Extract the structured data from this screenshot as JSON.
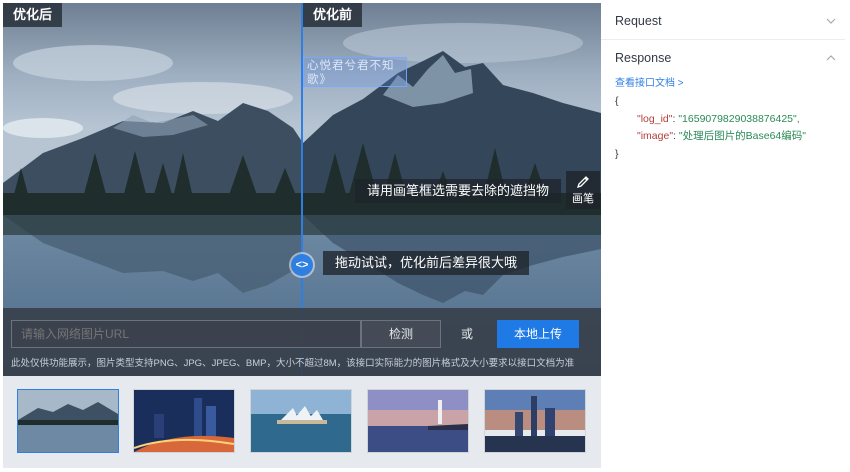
{
  "demo": {
    "after_label": "优化后",
    "before_label": "优化前",
    "watermark_text": "心悦君兮君不知\n歌》",
    "tip_brush": "请用画笔框选需要去除的遮挡物",
    "tip_drag": "拖动试试，优化前后差异很大哦",
    "pen_label": "画笔",
    "handle_glyph": "<>",
    "url_placeholder": "请输入网络图片URL",
    "detect_label": "检测",
    "or_label": "或",
    "upload_label": "本地上传",
    "hint": "此处仅供功能展示，图片类型支持PNG、JPG、JPEG、BMP，大小不超过8M，该接口实际能力的图片格式及大小要求以接口文档为准"
  },
  "thumbnails": [
    {
      "name": "lake-mountains",
      "selected": true
    },
    {
      "name": "city-night-traffic",
      "selected": false
    },
    {
      "name": "opera-house-harbor",
      "selected": false
    },
    {
      "name": "lighthouse-sunset",
      "selected": false
    },
    {
      "name": "city-skyline-dusk",
      "selected": false
    }
  ],
  "panel": {
    "request_title": "Request",
    "response_title": "Response",
    "doc_link": "查看接口文档 >",
    "json_open": "{",
    "json_close": "}",
    "log_id_key": "\"log_id\"",
    "log_id_value": "\"1659079829038876425\",",
    "image_key": "\"image\"",
    "image_value": "\"处理后图片的Base64编码\"",
    "colon": ": "
  },
  "colors": {
    "accent": "#2f7fe3",
    "upload_button": "#1f7ae6",
    "json_key": "#b0413e",
    "json_string": "#2a8a56"
  }
}
